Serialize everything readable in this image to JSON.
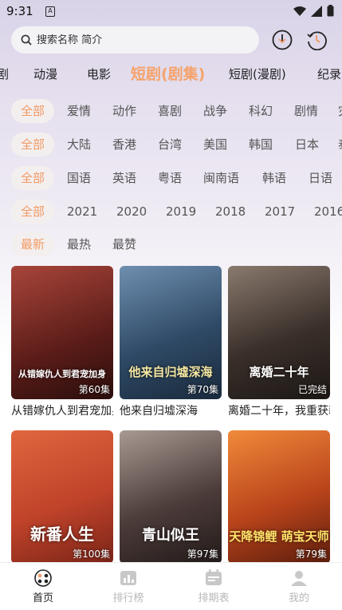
{
  "status": {
    "time": "9:31",
    "sim_label": "A"
  },
  "search": {
    "placeholder": "搜索名称 简介"
  },
  "top_actions": {
    "download_icon": "download-icon",
    "history_icon": "history-icon"
  },
  "main_tabs": [
    {
      "label": "剧",
      "active": false
    },
    {
      "label": "动漫",
      "active": false
    },
    {
      "label": "电影",
      "active": false
    },
    {
      "label": "短剧(剧集)",
      "active": true
    },
    {
      "label": "短剧(漫剧)",
      "active": false
    },
    {
      "label": "纪录",
      "active": false
    }
  ],
  "filters": {
    "genre": [
      "全部",
      "爱情",
      "动作",
      "喜剧",
      "战争",
      "科幻",
      "剧情",
      "灾"
    ],
    "region": [
      "全部",
      "大陆",
      "香港",
      "台湾",
      "美国",
      "韩国",
      "日本",
      "泰"
    ],
    "language": [
      "全部",
      "国语",
      "英语",
      "粤语",
      "闽南语",
      "韩语",
      "日语"
    ],
    "year": [
      "全部",
      "2021",
      "2020",
      "2019",
      "2018",
      "2017",
      "2016"
    ],
    "sort": [
      "最新",
      "最热",
      "最赞"
    ]
  },
  "cards": [
    {
      "title": "从错嫁仇人到君宠加身",
      "art": "从错嫁仇人到君宠加身",
      "badge": "第60集",
      "bg": "#7a2a24"
    },
    {
      "title": "他来自归墟深海",
      "art": "他来自归墟深海",
      "badge": "第70集",
      "bg": "#2f4a66"
    },
    {
      "title": "离婚二十年，我重获新生",
      "art": "离婚二十年",
      "badge": "已完结",
      "bg": "#3a2f2a"
    },
    {
      "title": "新番人生",
      "art": "新番人生",
      "badge": "第100集",
      "bg": "#c0432a"
    },
    {
      "title": "青山似王",
      "art": "青山似王",
      "badge": "第97集",
      "bg": "#4c3c3a"
    },
    {
      "title": "天降锦鲤，萌宝天师",
      "art": "天降锦鲤 萌宝天师",
      "badge": "第79集",
      "bg": "#b9441b"
    }
  ],
  "bottom_nav": [
    {
      "label": "首页",
      "active": true
    },
    {
      "label": "排行榜",
      "active": false
    },
    {
      "label": "排期表",
      "active": false
    },
    {
      "label": "我的",
      "active": false
    }
  ],
  "colors": {
    "accent": "#f6a36c",
    "chip_bg": "#f3efef"
  }
}
